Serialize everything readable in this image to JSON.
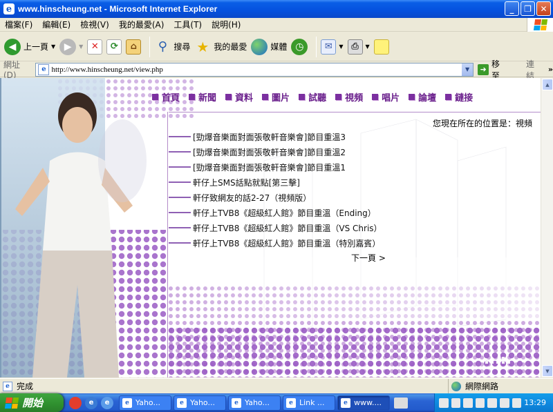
{
  "window": {
    "title": "www.hinscheung.net - Microsoft Internet Explorer"
  },
  "menu": [
    "檔案(F)",
    "編輯(E)",
    "檢視(V)",
    "我的最愛(A)",
    "工具(T)",
    "說明(H)"
  ],
  "toolbar": {
    "back": "上一頁",
    "search": "搜尋",
    "favorites": "我的最愛",
    "media": "媒體"
  },
  "address": {
    "label": "網址(D)",
    "url": "http://www.hinscheung.net/view.php",
    "go": "移至",
    "links": "連結"
  },
  "page": {
    "nav": [
      "首頁",
      "新聞",
      "資料",
      "圖片",
      "試聽",
      "視頻",
      "唱片",
      "論壇",
      "鏈接"
    ],
    "location": "您現在所在的位置是：視頻",
    "items": [
      "[勁爆音樂面對面張敬軒音樂會]節目重溫3",
      "[勁爆音樂面對面張敬軒音樂會]節目重溫2",
      "[勁爆音樂面對面張敬軒音樂會]節目重溫1",
      "軒仔上SMS話點就點[第三擊]",
      "軒仔致網友的話2-27（視頻版）",
      "軒仔上TVB8《超級紅人館》節目重溫（Ending）",
      "軒仔上TVB8《超級紅人館》節目重溫（VS Chris）",
      "軒仔上TVB8《超級紅人館》節目重溫（特別嘉賓）"
    ],
    "next": "下一頁 >"
  },
  "status": {
    "text": "完成",
    "zone": "網際網路"
  },
  "taskbar": {
    "start": "開始",
    "tasks": [
      "Yaho...",
      "Yaho...",
      "Yaho...",
      "Link ...",
      "www...."
    ],
    "clock": "13:29"
  }
}
